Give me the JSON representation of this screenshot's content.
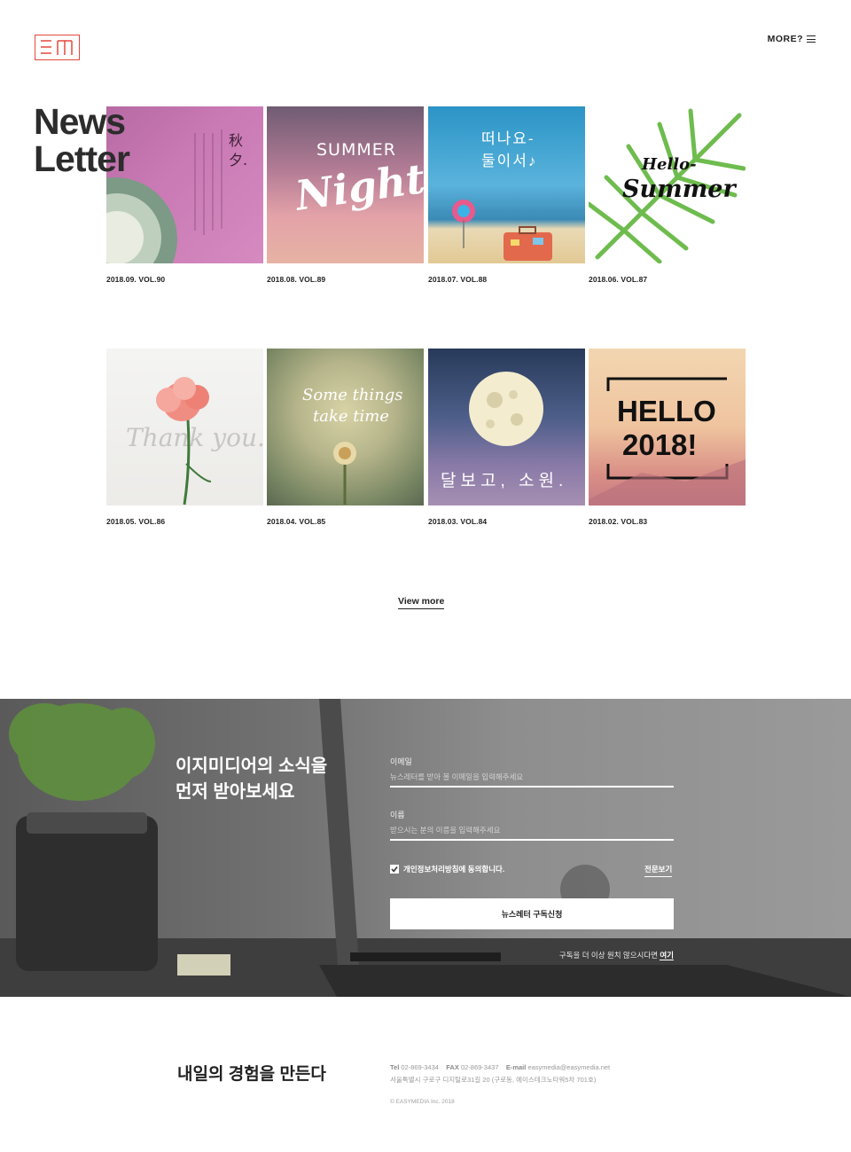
{
  "header": {
    "more_label": "MORE?"
  },
  "page": {
    "title_line1": "News",
    "title_line2": "Letter"
  },
  "thumbnail_texts": {
    "vol90": "秋夕.",
    "vol89_a": "SUMMER",
    "vol89_b": "Night",
    "vol88_a": "떠나요-",
    "vol88_b": "둘이서♪",
    "vol87_a": "Hello-",
    "vol87_b": "Summer",
    "vol86": "Thank you.",
    "vol85_a": "Some things",
    "vol85_b": "take time",
    "vol84": "달보고, 소원.",
    "vol83_a": "HELLO",
    "vol83_b": "2018!"
  },
  "newsletters": [
    {
      "caption": "2018.09. VOL.90"
    },
    {
      "caption": "2018.08. VOL.89"
    },
    {
      "caption": "2018.07. VOL.88"
    },
    {
      "caption": "2018.06. VOL.87"
    },
    {
      "caption": "2018.05. VOL.86"
    },
    {
      "caption": "2018.04. VOL.85"
    },
    {
      "caption": "2018.03. VOL.84"
    },
    {
      "caption": "2018.02. VOL.83"
    }
  ],
  "view_more": "View more",
  "subscribe": {
    "title_line1": "이지미디어의 소식을",
    "title_line2": "먼저 받아보세요",
    "email_label": "이메일",
    "email_placeholder": "뉴스레터를 받아 볼 이메일을 입력해주세요",
    "name_label": "이름",
    "name_placeholder": "받으시는 분의 이름을 입력해주세요",
    "agree_label": "개인정보처리방침에 동의합니다.",
    "terms_link": "전문보기",
    "submit_label": "뉴스레터 구독신청",
    "unsub_text": "구독을 더 이상 원치 않으시다면",
    "unsub_link": "여기"
  },
  "footer": {
    "slogan": "내일의 경험을 만든다",
    "tel_label": "Tel",
    "tel": "02-869-3434",
    "fax_label": "FAX",
    "fax": "02-869-3437",
    "email_label": "E-mail",
    "email": "easymedia@easymedia.net",
    "address": "서울특별시 구로구 디지털로31길 20 (구로동, 에이스테크노타워5차 701호)",
    "copyright": "© EASYMEDIA Inc. 2018"
  },
  "colors": {
    "accent": "#e2483c",
    "text": "#222222"
  },
  "icons": {
    "logo": "em-logo",
    "menu": "menu-icon",
    "check": "check-icon"
  }
}
